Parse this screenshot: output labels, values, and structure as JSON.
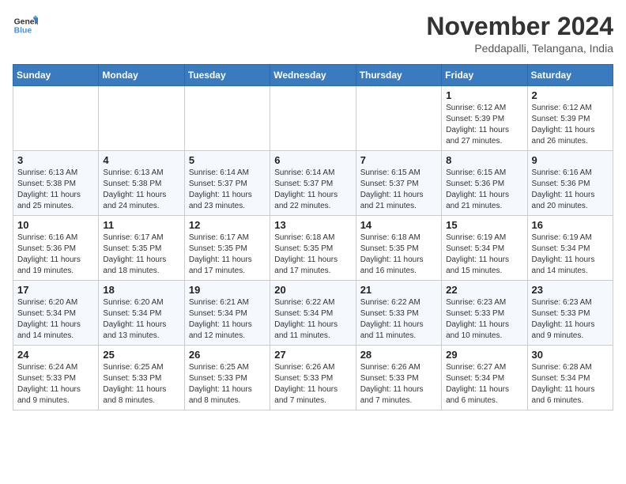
{
  "logo": {
    "line1": "General",
    "line2": "Blue"
  },
  "title": "November 2024",
  "location": "Peddapalli, Telangana, India",
  "days_header": [
    "Sunday",
    "Monday",
    "Tuesday",
    "Wednesday",
    "Thursday",
    "Friday",
    "Saturday"
  ],
  "weeks": [
    [
      {
        "day": "",
        "info": ""
      },
      {
        "day": "",
        "info": ""
      },
      {
        "day": "",
        "info": ""
      },
      {
        "day": "",
        "info": ""
      },
      {
        "day": "",
        "info": ""
      },
      {
        "day": "1",
        "info": "Sunrise: 6:12 AM\nSunset: 5:39 PM\nDaylight: 11 hours and 27 minutes."
      },
      {
        "day": "2",
        "info": "Sunrise: 6:12 AM\nSunset: 5:39 PM\nDaylight: 11 hours and 26 minutes."
      }
    ],
    [
      {
        "day": "3",
        "info": "Sunrise: 6:13 AM\nSunset: 5:38 PM\nDaylight: 11 hours and 25 minutes."
      },
      {
        "day": "4",
        "info": "Sunrise: 6:13 AM\nSunset: 5:38 PM\nDaylight: 11 hours and 24 minutes."
      },
      {
        "day": "5",
        "info": "Sunrise: 6:14 AM\nSunset: 5:37 PM\nDaylight: 11 hours and 23 minutes."
      },
      {
        "day": "6",
        "info": "Sunrise: 6:14 AM\nSunset: 5:37 PM\nDaylight: 11 hours and 22 minutes."
      },
      {
        "day": "7",
        "info": "Sunrise: 6:15 AM\nSunset: 5:37 PM\nDaylight: 11 hours and 21 minutes."
      },
      {
        "day": "8",
        "info": "Sunrise: 6:15 AM\nSunset: 5:36 PM\nDaylight: 11 hours and 21 minutes."
      },
      {
        "day": "9",
        "info": "Sunrise: 6:16 AM\nSunset: 5:36 PM\nDaylight: 11 hours and 20 minutes."
      }
    ],
    [
      {
        "day": "10",
        "info": "Sunrise: 6:16 AM\nSunset: 5:36 PM\nDaylight: 11 hours and 19 minutes."
      },
      {
        "day": "11",
        "info": "Sunrise: 6:17 AM\nSunset: 5:35 PM\nDaylight: 11 hours and 18 minutes."
      },
      {
        "day": "12",
        "info": "Sunrise: 6:17 AM\nSunset: 5:35 PM\nDaylight: 11 hours and 17 minutes."
      },
      {
        "day": "13",
        "info": "Sunrise: 6:18 AM\nSunset: 5:35 PM\nDaylight: 11 hours and 17 minutes."
      },
      {
        "day": "14",
        "info": "Sunrise: 6:18 AM\nSunset: 5:35 PM\nDaylight: 11 hours and 16 minutes."
      },
      {
        "day": "15",
        "info": "Sunrise: 6:19 AM\nSunset: 5:34 PM\nDaylight: 11 hours and 15 minutes."
      },
      {
        "day": "16",
        "info": "Sunrise: 6:19 AM\nSunset: 5:34 PM\nDaylight: 11 hours and 14 minutes."
      }
    ],
    [
      {
        "day": "17",
        "info": "Sunrise: 6:20 AM\nSunset: 5:34 PM\nDaylight: 11 hours and 14 minutes."
      },
      {
        "day": "18",
        "info": "Sunrise: 6:20 AM\nSunset: 5:34 PM\nDaylight: 11 hours and 13 minutes."
      },
      {
        "day": "19",
        "info": "Sunrise: 6:21 AM\nSunset: 5:34 PM\nDaylight: 11 hours and 12 minutes."
      },
      {
        "day": "20",
        "info": "Sunrise: 6:22 AM\nSunset: 5:34 PM\nDaylight: 11 hours and 11 minutes."
      },
      {
        "day": "21",
        "info": "Sunrise: 6:22 AM\nSunset: 5:33 PM\nDaylight: 11 hours and 11 minutes."
      },
      {
        "day": "22",
        "info": "Sunrise: 6:23 AM\nSunset: 5:33 PM\nDaylight: 11 hours and 10 minutes."
      },
      {
        "day": "23",
        "info": "Sunrise: 6:23 AM\nSunset: 5:33 PM\nDaylight: 11 hours and 9 minutes."
      }
    ],
    [
      {
        "day": "24",
        "info": "Sunrise: 6:24 AM\nSunset: 5:33 PM\nDaylight: 11 hours and 9 minutes."
      },
      {
        "day": "25",
        "info": "Sunrise: 6:25 AM\nSunset: 5:33 PM\nDaylight: 11 hours and 8 minutes."
      },
      {
        "day": "26",
        "info": "Sunrise: 6:25 AM\nSunset: 5:33 PM\nDaylight: 11 hours and 8 minutes."
      },
      {
        "day": "27",
        "info": "Sunrise: 6:26 AM\nSunset: 5:33 PM\nDaylight: 11 hours and 7 minutes."
      },
      {
        "day": "28",
        "info": "Sunrise: 6:26 AM\nSunset: 5:33 PM\nDaylight: 11 hours and 7 minutes."
      },
      {
        "day": "29",
        "info": "Sunrise: 6:27 AM\nSunset: 5:34 PM\nDaylight: 11 hours and 6 minutes."
      },
      {
        "day": "30",
        "info": "Sunrise: 6:28 AM\nSunset: 5:34 PM\nDaylight: 11 hours and 6 minutes."
      }
    ]
  ]
}
